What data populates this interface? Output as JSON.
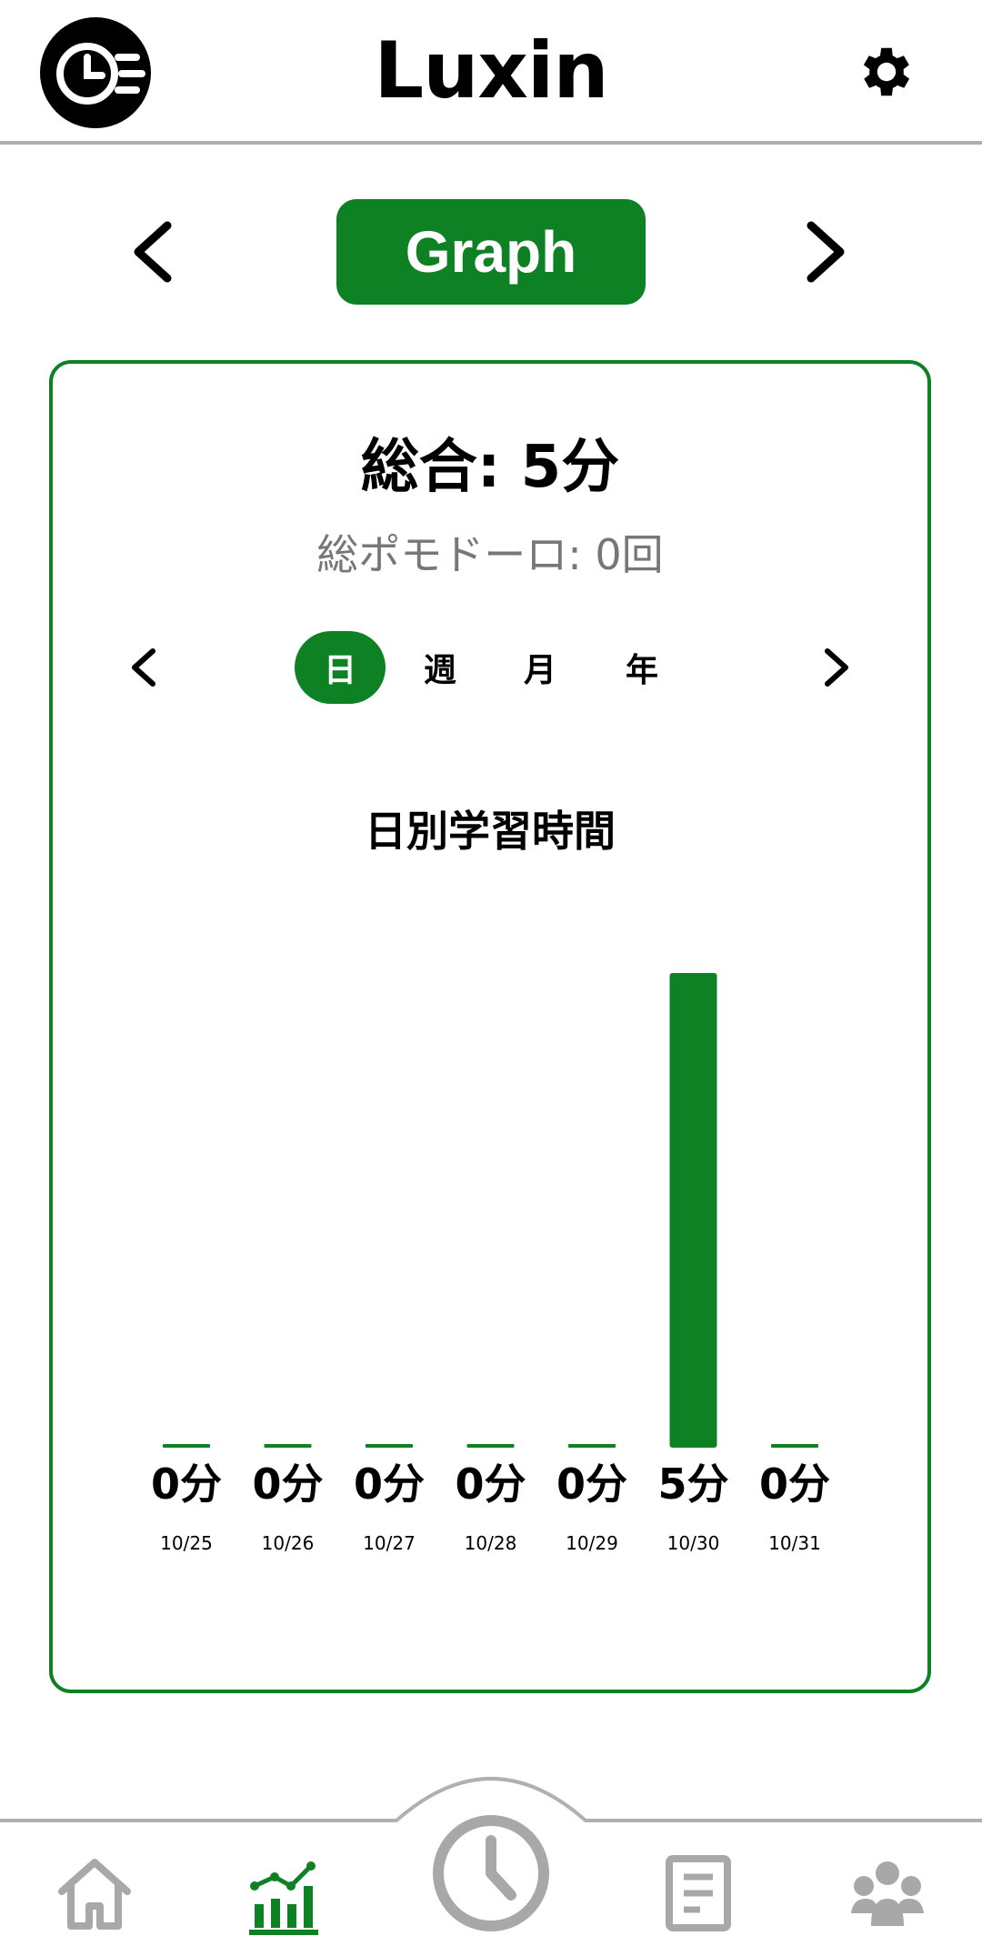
{
  "header": {
    "title": "Luxin",
    "logo_icon": "clock-speed-logo-icon",
    "settings_icon": "gear-icon"
  },
  "page_switcher": {
    "label": "Graph",
    "prev_icon": "chevron-left-icon",
    "next_icon": "chevron-right-icon"
  },
  "summary": {
    "total": "総合: 5分",
    "pomodoro": "総ポモドーロ: 0回"
  },
  "period_tabs": [
    {
      "label": "日",
      "active": true
    },
    {
      "label": "週",
      "active": false
    },
    {
      "label": "月",
      "active": false
    },
    {
      "label": "年",
      "active": false
    }
  ],
  "chart_data": {
    "type": "bar",
    "title": "日別学習時間",
    "categories": [
      "10/25",
      "10/26",
      "10/27",
      "10/28",
      "10/29",
      "10/30",
      "10/31"
    ],
    "values": [
      0,
      0,
      0,
      0,
      0,
      5,
      0
    ],
    "value_labels": [
      "0分",
      "0分",
      "0分",
      "0分",
      "0分",
      "5分",
      "0分"
    ],
    "ylim": [
      0,
      5
    ],
    "bar_color": "#0f8125",
    "grid": false,
    "legend": "none"
  },
  "bottom_nav": {
    "items": [
      {
        "name": "home-icon",
        "active": false
      },
      {
        "name": "stats-chart-icon",
        "active": true
      },
      {
        "name": "timer-clock-icon",
        "active": false
      },
      {
        "name": "notes-icon",
        "active": false
      },
      {
        "name": "group-icon",
        "active": false
      }
    ]
  },
  "colors": {
    "accent": "#0f8125",
    "inactive": "#a8a8a8",
    "divider": "#b0b0b0"
  }
}
